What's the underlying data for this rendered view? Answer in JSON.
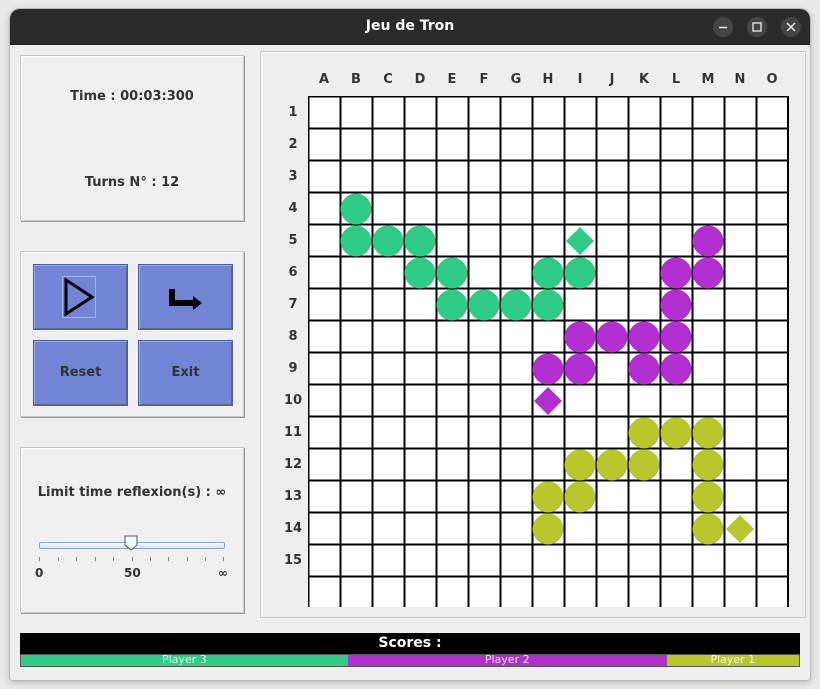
{
  "window": {
    "title": "Jeu de Tron"
  },
  "info": {
    "time": "Time : 00:03:300",
    "turns": "Turns N° : 12"
  },
  "buttons": {
    "reset": "Reset",
    "exit": "Exit"
  },
  "limit": {
    "label": "Limit time reflexion(s) : ∞",
    "min": "0",
    "mid": "50",
    "max": "∞",
    "value": 50
  },
  "board": {
    "columns": [
      "A",
      "B",
      "C",
      "D",
      "E",
      "F",
      "G",
      "H",
      "I",
      "J",
      "K",
      "L",
      "M",
      "N",
      "O"
    ],
    "rows": [
      "1",
      "2",
      "3",
      "4",
      "5",
      "6",
      "7",
      "8",
      "9",
      "10",
      "11",
      "12",
      "13",
      "14",
      "15"
    ],
    "players": [
      {
        "name": "Player 3",
        "color": "#2ecc87",
        "trail": [
          [
            1,
            4
          ],
          [
            1,
            5
          ],
          [
            2,
            5
          ],
          [
            3,
            5
          ],
          [
            3,
            6
          ],
          [
            4,
            6
          ],
          [
            4,
            7
          ],
          [
            5,
            7
          ],
          [
            6,
            7
          ],
          [
            7,
            7
          ],
          [
            7,
            6
          ],
          [
            8,
            6
          ]
        ],
        "head": [
          8,
          5
        ]
      },
      {
        "name": "Player 2",
        "color": "#b12fcf",
        "trail": [
          [
            12,
            5
          ],
          [
            12,
            6
          ],
          [
            11,
            6
          ],
          [
            11,
            7
          ],
          [
            11,
            8
          ],
          [
            10,
            8
          ],
          [
            9,
            8
          ],
          [
            8,
            8
          ],
          [
            8,
            9
          ],
          [
            7,
            9
          ],
          [
            10,
            9
          ],
          [
            11,
            9
          ]
        ],
        "head": [
          7,
          10
        ]
      },
      {
        "name": "Player 1",
        "color": "#b8c82b",
        "trail": [
          [
            12,
            11
          ],
          [
            11,
            11
          ],
          [
            10,
            11
          ],
          [
            12,
            12
          ],
          [
            12,
            13
          ],
          [
            12,
            14
          ],
          [
            10,
            12
          ],
          [
            9,
            12
          ],
          [
            8,
            12
          ],
          [
            8,
            13
          ],
          [
            7,
            13
          ],
          [
            7,
            14
          ]
        ],
        "head": [
          13,
          14
        ]
      }
    ]
  },
  "scores": {
    "title": "Scores :",
    "segments": [
      {
        "name": "Player 3",
        "color": "#2ecc87",
        "share": 0.42
      },
      {
        "name": "Player 2",
        "color": "#b12fcf",
        "share": 0.41
      },
      {
        "name": "Player 1",
        "color": "#b8c82b",
        "share": 0.17
      }
    ]
  }
}
